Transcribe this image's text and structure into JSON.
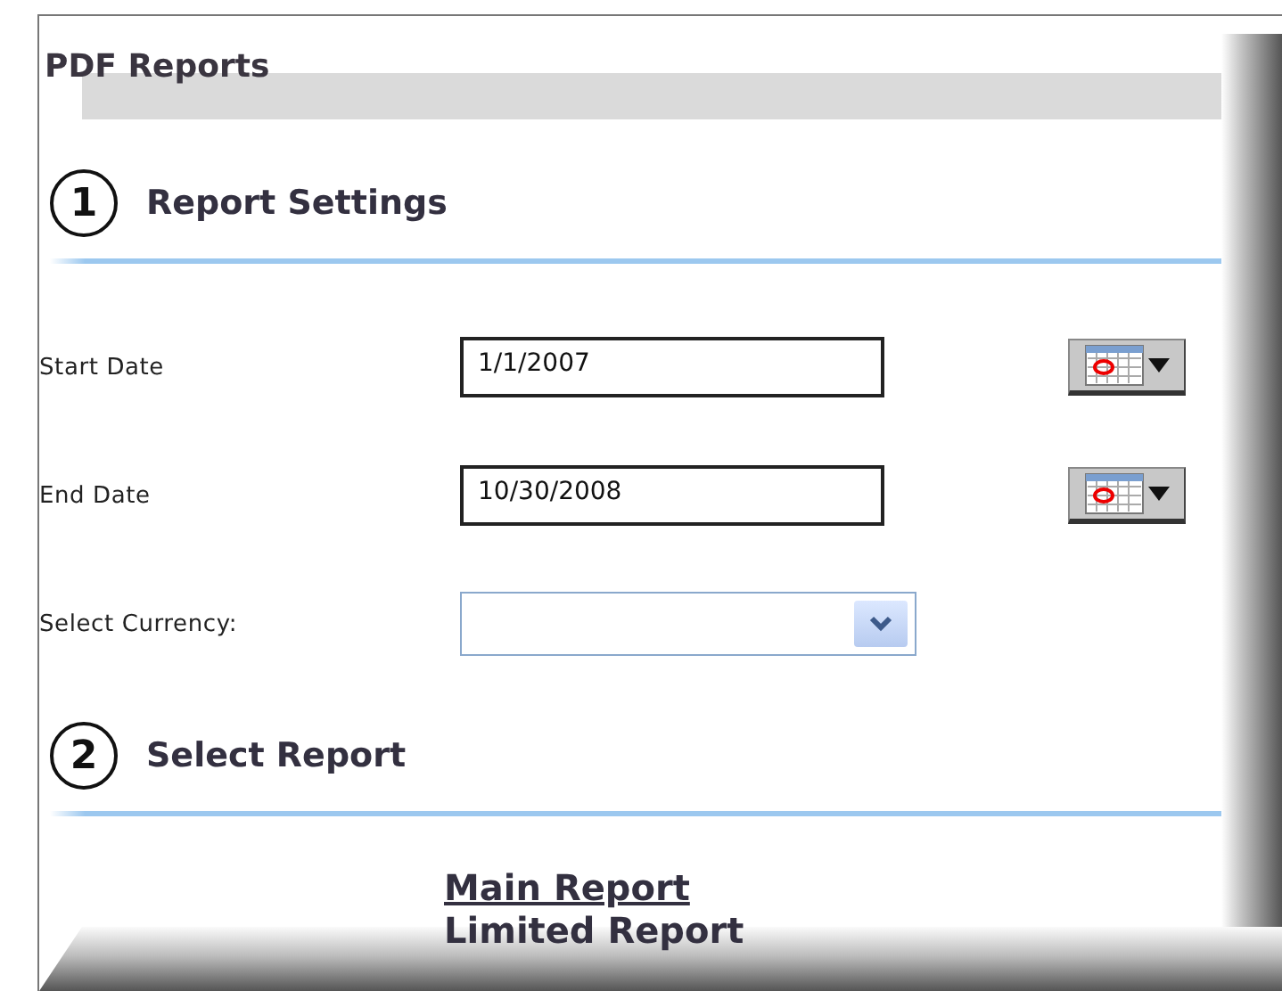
{
  "title": "PDF Reports",
  "settings": {
    "number": "1",
    "heading": "Report Settings",
    "fields": [
      {
        "kind": "date",
        "label": "Start Date",
        "value": "1/1/2007"
      },
      {
        "kind": "date",
        "label": "End Date",
        "value": "10/30/2008"
      },
      {
        "kind": "select",
        "label": "Select Currency:"
      }
    ]
  },
  "report": {
    "number": "2",
    "heading": "Select Report",
    "links": [
      {
        "label": "Main Report",
        "hovered": true
      },
      {
        "label": "Limited Report",
        "hovered": false
      }
    ]
  }
}
